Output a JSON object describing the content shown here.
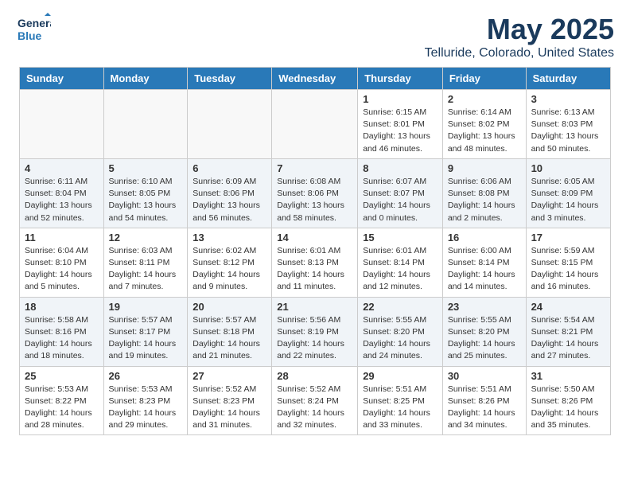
{
  "header": {
    "logo_line1": "General",
    "logo_line2": "Blue",
    "title": "May 2025",
    "subtitle": "Telluride, Colorado, United States"
  },
  "weekdays": [
    "Sunday",
    "Monday",
    "Tuesday",
    "Wednesday",
    "Thursday",
    "Friday",
    "Saturday"
  ],
  "weeks": [
    [
      {
        "day": "",
        "empty": true
      },
      {
        "day": "",
        "empty": true
      },
      {
        "day": "",
        "empty": true
      },
      {
        "day": "",
        "empty": true
      },
      {
        "day": "1",
        "sunrise": "6:15 AM",
        "sunset": "8:01 PM",
        "daylight": "13 hours and 46 minutes."
      },
      {
        "day": "2",
        "sunrise": "6:14 AM",
        "sunset": "8:02 PM",
        "daylight": "13 hours and 48 minutes."
      },
      {
        "day": "3",
        "sunrise": "6:13 AM",
        "sunset": "8:03 PM",
        "daylight": "13 hours and 50 minutes."
      }
    ],
    [
      {
        "day": "4",
        "sunrise": "6:11 AM",
        "sunset": "8:04 PM",
        "daylight": "13 hours and 52 minutes."
      },
      {
        "day": "5",
        "sunrise": "6:10 AM",
        "sunset": "8:05 PM",
        "daylight": "13 hours and 54 minutes."
      },
      {
        "day": "6",
        "sunrise": "6:09 AM",
        "sunset": "8:06 PM",
        "daylight": "13 hours and 56 minutes."
      },
      {
        "day": "7",
        "sunrise": "6:08 AM",
        "sunset": "8:06 PM",
        "daylight": "13 hours and 58 minutes."
      },
      {
        "day": "8",
        "sunrise": "6:07 AM",
        "sunset": "8:07 PM",
        "daylight": "14 hours and 0 minutes."
      },
      {
        "day": "9",
        "sunrise": "6:06 AM",
        "sunset": "8:08 PM",
        "daylight": "14 hours and 2 minutes."
      },
      {
        "day": "10",
        "sunrise": "6:05 AM",
        "sunset": "8:09 PM",
        "daylight": "14 hours and 3 minutes."
      }
    ],
    [
      {
        "day": "11",
        "sunrise": "6:04 AM",
        "sunset": "8:10 PM",
        "daylight": "14 hours and 5 minutes."
      },
      {
        "day": "12",
        "sunrise": "6:03 AM",
        "sunset": "8:11 PM",
        "daylight": "14 hours and 7 minutes."
      },
      {
        "day": "13",
        "sunrise": "6:02 AM",
        "sunset": "8:12 PM",
        "daylight": "14 hours and 9 minutes."
      },
      {
        "day": "14",
        "sunrise": "6:01 AM",
        "sunset": "8:13 PM",
        "daylight": "14 hours and 11 minutes."
      },
      {
        "day": "15",
        "sunrise": "6:01 AM",
        "sunset": "8:14 PM",
        "daylight": "14 hours and 12 minutes."
      },
      {
        "day": "16",
        "sunrise": "6:00 AM",
        "sunset": "8:14 PM",
        "daylight": "14 hours and 14 minutes."
      },
      {
        "day": "17",
        "sunrise": "5:59 AM",
        "sunset": "8:15 PM",
        "daylight": "14 hours and 16 minutes."
      }
    ],
    [
      {
        "day": "18",
        "sunrise": "5:58 AM",
        "sunset": "8:16 PM",
        "daylight": "14 hours and 18 minutes."
      },
      {
        "day": "19",
        "sunrise": "5:57 AM",
        "sunset": "8:17 PM",
        "daylight": "14 hours and 19 minutes."
      },
      {
        "day": "20",
        "sunrise": "5:57 AM",
        "sunset": "8:18 PM",
        "daylight": "14 hours and 21 minutes."
      },
      {
        "day": "21",
        "sunrise": "5:56 AM",
        "sunset": "8:19 PM",
        "daylight": "14 hours and 22 minutes."
      },
      {
        "day": "22",
        "sunrise": "5:55 AM",
        "sunset": "8:20 PM",
        "daylight": "14 hours and 24 minutes."
      },
      {
        "day": "23",
        "sunrise": "5:55 AM",
        "sunset": "8:20 PM",
        "daylight": "14 hours and 25 minutes."
      },
      {
        "day": "24",
        "sunrise": "5:54 AM",
        "sunset": "8:21 PM",
        "daylight": "14 hours and 27 minutes."
      }
    ],
    [
      {
        "day": "25",
        "sunrise": "5:53 AM",
        "sunset": "8:22 PM",
        "daylight": "14 hours and 28 minutes."
      },
      {
        "day": "26",
        "sunrise": "5:53 AM",
        "sunset": "8:23 PM",
        "daylight": "14 hours and 29 minutes."
      },
      {
        "day": "27",
        "sunrise": "5:52 AM",
        "sunset": "8:23 PM",
        "daylight": "14 hours and 31 minutes."
      },
      {
        "day": "28",
        "sunrise": "5:52 AM",
        "sunset": "8:24 PM",
        "daylight": "14 hours and 32 minutes."
      },
      {
        "day": "29",
        "sunrise": "5:51 AM",
        "sunset": "8:25 PM",
        "daylight": "14 hours and 33 minutes."
      },
      {
        "day": "30",
        "sunrise": "5:51 AM",
        "sunset": "8:26 PM",
        "daylight": "14 hours and 34 minutes."
      },
      {
        "day": "31",
        "sunrise": "5:50 AM",
        "sunset": "8:26 PM",
        "daylight": "14 hours and 35 minutes."
      }
    ]
  ]
}
